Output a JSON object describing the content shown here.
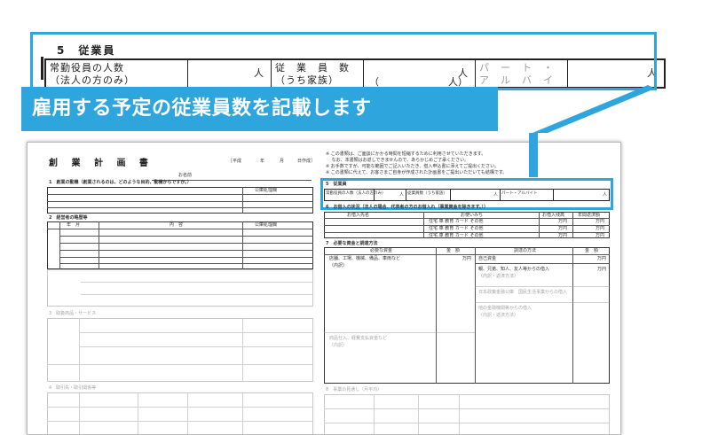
{
  "banner": {
    "text": "雇用する予定の従業員数を記載します"
  },
  "callout": {
    "section_title": "5　従業員",
    "cells": [
      {
        "label_line1": "常勤役員の人数",
        "label_line2": "（法人の方のみ）",
        "unit": "人"
      },
      {
        "label_line1": "従　業　員　数",
        "label_line2": "（うち家族）",
        "unit": "人",
        "paren_open": "（",
        "unit2": "人）"
      },
      {
        "label_line1": "パ　ー　ト　・",
        "label_line2": "ア　ル　バ　イ　ト",
        "unit": "人"
      }
    ]
  },
  "form": {
    "title": "創 業 計 画 書",
    "header_meta": [
      "［平成",
      "年",
      "月",
      "日作成］"
    ],
    "name_label": "お名前",
    "notes": [
      "※ この書類は、ご面談にかかる時間を短縮するために利用させていただきます。",
      "　 なお、本書類はお返しできませんので、あらかじめご了承ください。",
      "※ お手数ですが、可能な範囲でご記入いただき、借入申込書に添えてご提出ください。",
      "※ この書類に代えて、お客さまご自身が作成された計画書をご提出いただいても結構です。"
    ],
    "sec1": "1　創業の動機（創業されるのは、どのような目的、動機からですか。）",
    "sec1_col": "公庫処理欄",
    "sec2": "2　経営者の略歴等",
    "sec2_cols": [
      "年　月",
      "内　容",
      "公庫処理欄"
    ],
    "sec3": "3　取扱商品・サービス",
    "sec4": "4　取引先・取引関係等",
    "sec5": "5　従業員",
    "sec6": "6　お借入の状況（法人の場合、代表者の方のお借入れ（事業資金を除きます。））",
    "sec6_cols": [
      "お借入先名",
      "お使いみち",
      "お借入残高",
      "年間返済額"
    ],
    "sec6_rows": [
      [
        "住宅",
        "車",
        "教育",
        "カード",
        "その他",
        "万円",
        "万円"
      ],
      [
        "住宅",
        "車",
        "教育",
        "カード",
        "その他",
        "万円",
        "万円"
      ],
      [
        "住宅",
        "車",
        "教育",
        "カード",
        "その他",
        "万円",
        "万円"
      ]
    ],
    "sec7": "7　必要な資金と調達方法",
    "sec7_cols": [
      "必要な資金",
      "金　額",
      "調達の方法",
      "金　額"
    ],
    "sec7_left": [
      "店舗、工場、機械、備品、車両など",
      "（内訳）",
      "商品仕入、経費支払資金など",
      "（内訳）"
    ],
    "sec7_right": [
      "自己資金",
      "親、兄弟、知人、友人等からの借入",
      "（内訳・返済方法）",
      "日本政策金融公庫　国民生活事業からの借入",
      "他の金融機関等からの借入",
      "（内訳・返済方法）"
    ],
    "unit_man": "万円",
    "sec8": "8　事業の見通し（月平均）",
    "mini": [
      "常勤役員の人数（法人の方のみ）",
      "人",
      "従業員数（うち家族）",
      "人",
      "パート・アルバイト",
      "人"
    ]
  },
  "colors": {
    "accent": "#2ea6dd",
    "ink": "#222222"
  }
}
